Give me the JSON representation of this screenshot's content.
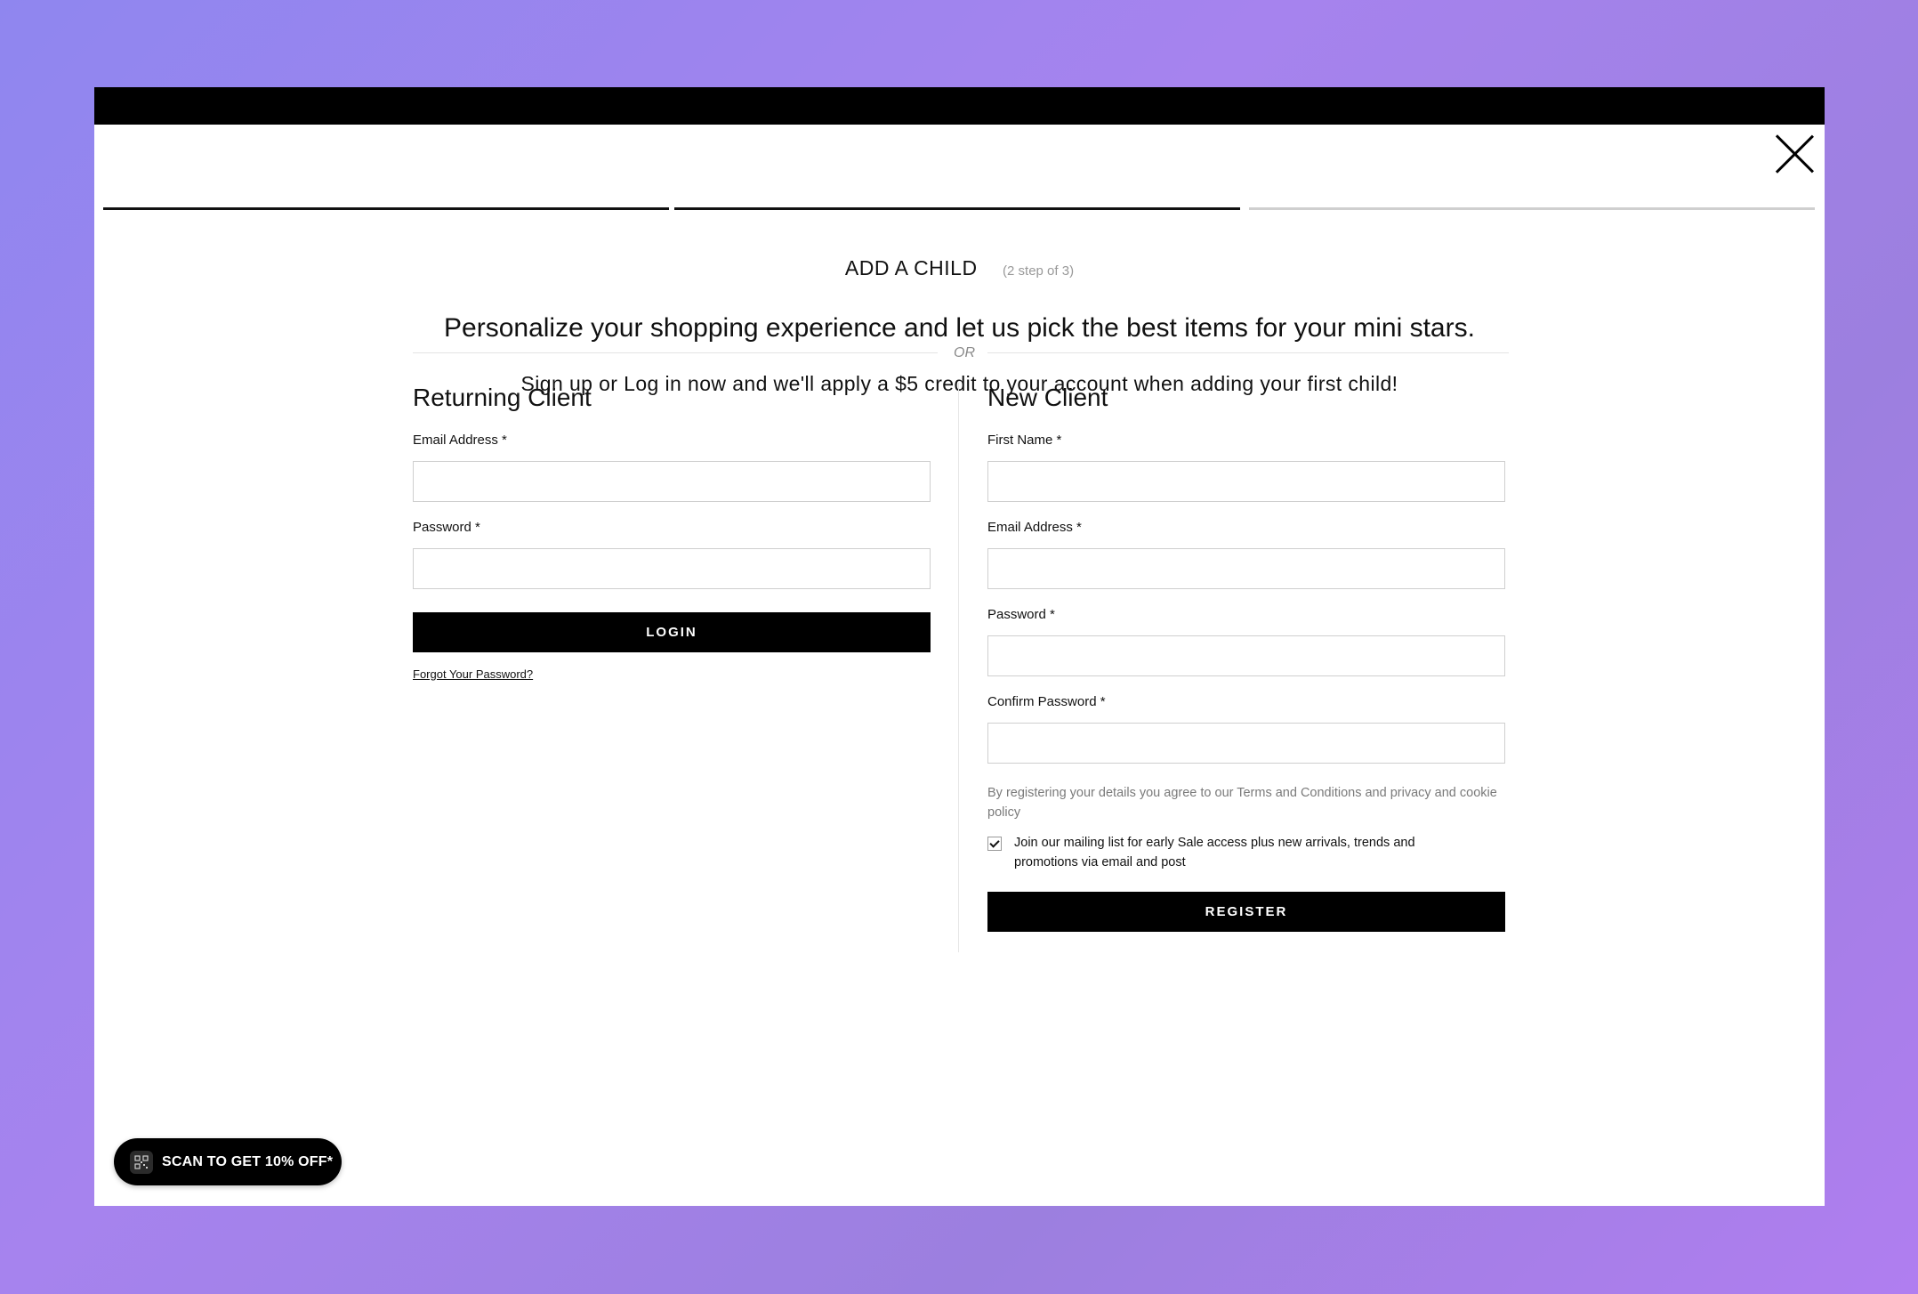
{
  "modal": {
    "title": "ADD A CHILD",
    "step_note": "(2 step of 3)",
    "close_icon": "close-icon",
    "headline": "Personalize your shopping experience and let us pick the best items for your mini stars.",
    "subline": "Sign up or Log in now and we'll apply a $5 credit to your account when adding your first child!",
    "divider_text": "OR",
    "progress": {
      "current_step": 2,
      "total_steps": 3
    }
  },
  "returning": {
    "heading": "Returning Client",
    "email_label": "Email Address *",
    "email_value": "",
    "password_label": "Password *",
    "password_value": "",
    "login_label": "LOGIN",
    "forgot_label": "Forgot Your Password?"
  },
  "new_client": {
    "heading": "New Client",
    "first_name_label": "First Name *",
    "first_name_value": "",
    "email_label": "Email Address *",
    "email_value": "",
    "password_label": "Password *",
    "password_value": "",
    "confirm_label": "Confirm Password *",
    "confirm_value": "",
    "terms_text": "By registering your details you agree to our Terms and Conditions and privacy and cookie policy",
    "mailing_checked": true,
    "mailing_text": "Join our mailing list for early Sale access plus new arrivals, trends and promotions via email and post",
    "register_label": "REGISTER"
  },
  "promo": {
    "label": "SCAN TO GET 10% OFF*",
    "icon": "qr-code-icon"
  },
  "colors": {
    "accent": "#000000",
    "muted_text": "#7a7a7a",
    "background_gradient_start": "#8f86ef",
    "background_gradient_end": "#b07ef0"
  }
}
